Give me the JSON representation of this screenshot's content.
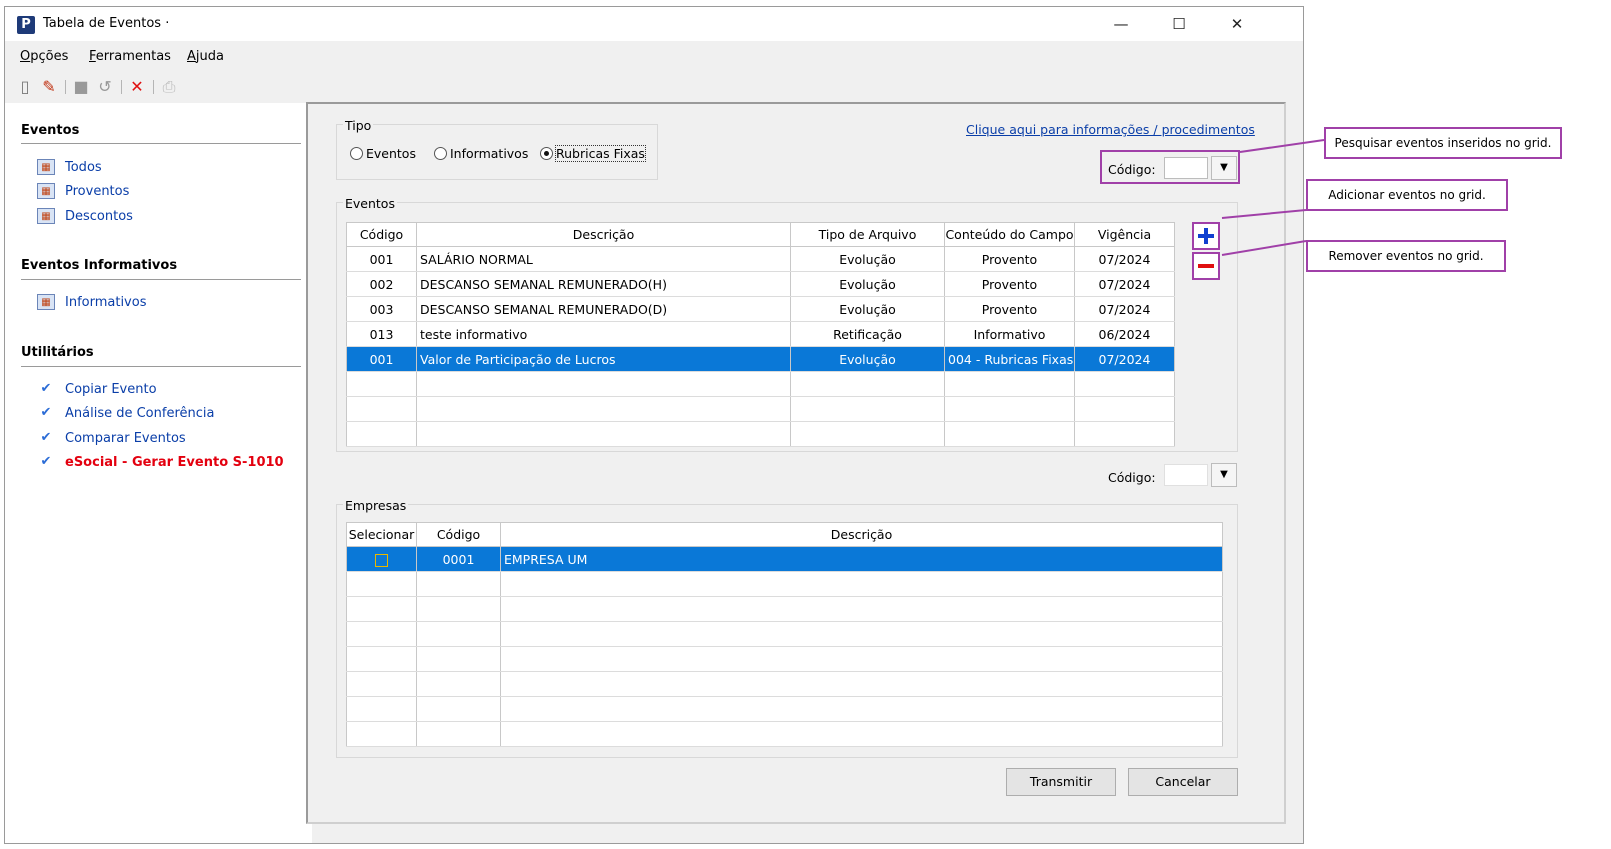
{
  "window": {
    "title": "Tabela de Eventos ·",
    "app_icon": "P",
    "minimize": "—",
    "maximize": "☐",
    "close": "✕"
  },
  "menu": [
    {
      "u": "O",
      "rest": "pções"
    },
    {
      "u": "F",
      "rest": "erramentas"
    },
    {
      "u": "A",
      "rest": "juda"
    }
  ],
  "toolbar": [
    "new-icon",
    "edit-icon",
    "save-icon",
    "undo-icon",
    "delete-icon",
    "print-icon"
  ],
  "sidebar": {
    "eventos": {
      "title": "Eventos",
      "items": [
        "Todos",
        "Proventos",
        "Descontos"
      ]
    },
    "informativos": {
      "title": "Eventos Informativos",
      "items": [
        "Informativos"
      ]
    },
    "utilitarios": {
      "title": "Utilitários",
      "items": [
        "Copiar Evento",
        "Análise de Conferência",
        "Comparar Eventos",
        "eSocial - Gerar Evento S-1010"
      ]
    }
  },
  "tipo": {
    "label": "Tipo",
    "options": [
      "Eventos",
      "Informativos",
      "Rubricas Fixas"
    ],
    "selected": "Rubricas Fixas"
  },
  "info_link": "Clique aqui para informações / procedimentos",
  "codigo_label": "Código:",
  "eventos": {
    "label": "Eventos",
    "columns": [
      "Código",
      "Descrição",
      "Tipo de Arquivo",
      "Conteúdo do Campo",
      "Vigência"
    ],
    "rows": [
      {
        "codigo": "001",
        "descricao": "SALÁRIO NORMAL",
        "tipo": "Evolução",
        "conteudo": "Provento",
        "vigencia": "07/2024"
      },
      {
        "codigo": "002",
        "descricao": "DESCANSO SEMANAL REMUNERADO(H)",
        "tipo": "Evolução",
        "conteudo": "Provento",
        "vigencia": "07/2024"
      },
      {
        "codigo": "003",
        "descricao": "DESCANSO SEMANAL REMUNERADO(D)",
        "tipo": "Evolução",
        "conteudo": "Provento",
        "vigencia": "07/2024"
      },
      {
        "codigo": "013",
        "descricao": "teste informativo",
        "tipo": "Retificação",
        "conteudo": "Informativo",
        "vigencia": "06/2024"
      },
      {
        "codigo": "001",
        "descricao": "Valor de Participação de Lucros",
        "tipo": "Evolução",
        "conteudo": "004 - Rubricas Fixas",
        "vigencia": "07/2024"
      }
    ],
    "selected_row": 4
  },
  "empresas": {
    "label": "Empresas",
    "columns": [
      "Selecionar",
      "Código",
      "Descrição"
    ],
    "rows": [
      {
        "codigo": "0001",
        "descricao": "EMPRESA UM"
      }
    ]
  },
  "buttons": {
    "transmitir": "Transmitir",
    "cancelar": "Cancelar"
  },
  "callouts": {
    "pesquisar": "Pesquisar eventos inseridos no grid.",
    "adicionar": "Adicionar eventos no grid.",
    "remover": "Remover eventos no grid."
  },
  "colors": {
    "selection": "#0a78d7",
    "link": "#0a3ea8",
    "callout_border": "#a040a8",
    "alert_link": "#e3000f"
  }
}
